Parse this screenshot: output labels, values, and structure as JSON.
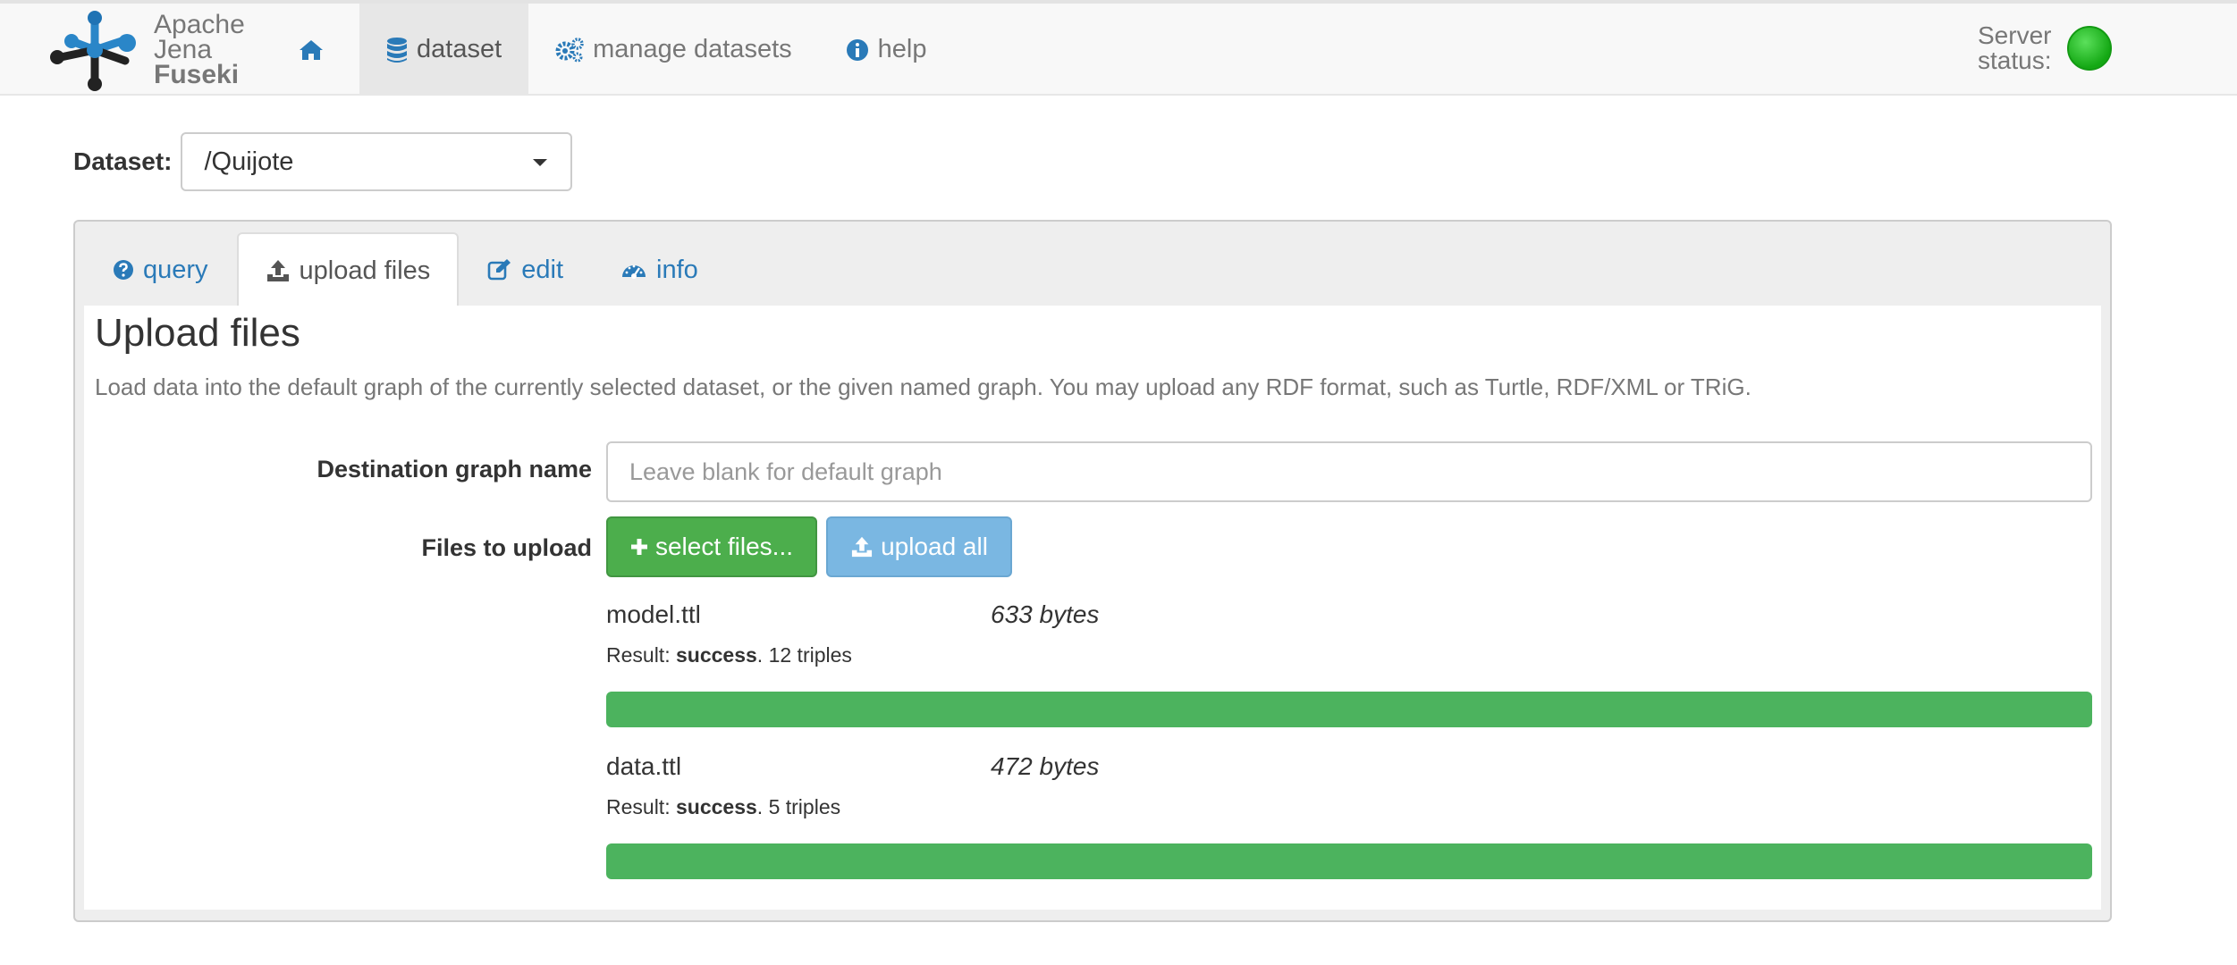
{
  "navbar": {
    "brand": {
      "line1": "Apache",
      "line2": "Jena",
      "line3": "Fuseki"
    },
    "items": [
      {
        "label": "",
        "icon": "home-icon"
      },
      {
        "label": "dataset",
        "icon": "database-icon",
        "active": true
      },
      {
        "label": "manage datasets",
        "icon": "cogs-icon"
      },
      {
        "label": "help",
        "icon": "info-circle-icon"
      }
    ],
    "status": {
      "label": "Server status:",
      "color": "#1fb51f"
    }
  },
  "dataset": {
    "label": "Dataset:",
    "selected": "/Quijote"
  },
  "tabs": [
    {
      "label": "query",
      "icon": "question-circle-icon"
    },
    {
      "label": "upload files",
      "icon": "upload-icon",
      "active": true
    },
    {
      "label": "edit",
      "icon": "edit-icon"
    },
    {
      "label": "info",
      "icon": "dashboard-icon"
    }
  ],
  "upload": {
    "title": "Upload files",
    "description": "Load data into the default graph of the currently selected dataset, or the given named graph. You may upload any RDF format, such as Turtle, RDF/XML or TRiG.",
    "graph_label": "Destination graph name",
    "graph_placeholder": "Leave blank for default graph",
    "files_label": "Files to upload",
    "select_button": "select files...",
    "upload_button": "upload all",
    "files": [
      {
        "name": "model.ttl",
        "size": "633 bytes",
        "result_prefix": "Result: ",
        "result_status": "success",
        "result_suffix": ". 12 triples",
        "progress": 1.0
      },
      {
        "name": "data.ttl",
        "size": "472 bytes",
        "result_prefix": "Result: ",
        "result_status": "success",
        "result_suffix": ". 5 triples",
        "progress": 1.0
      }
    ]
  },
  "colors": {
    "link": "#2a7ab8",
    "success": "#4cae4c",
    "upload_button": "#7ab7e2",
    "progress": "#4cb35e"
  }
}
